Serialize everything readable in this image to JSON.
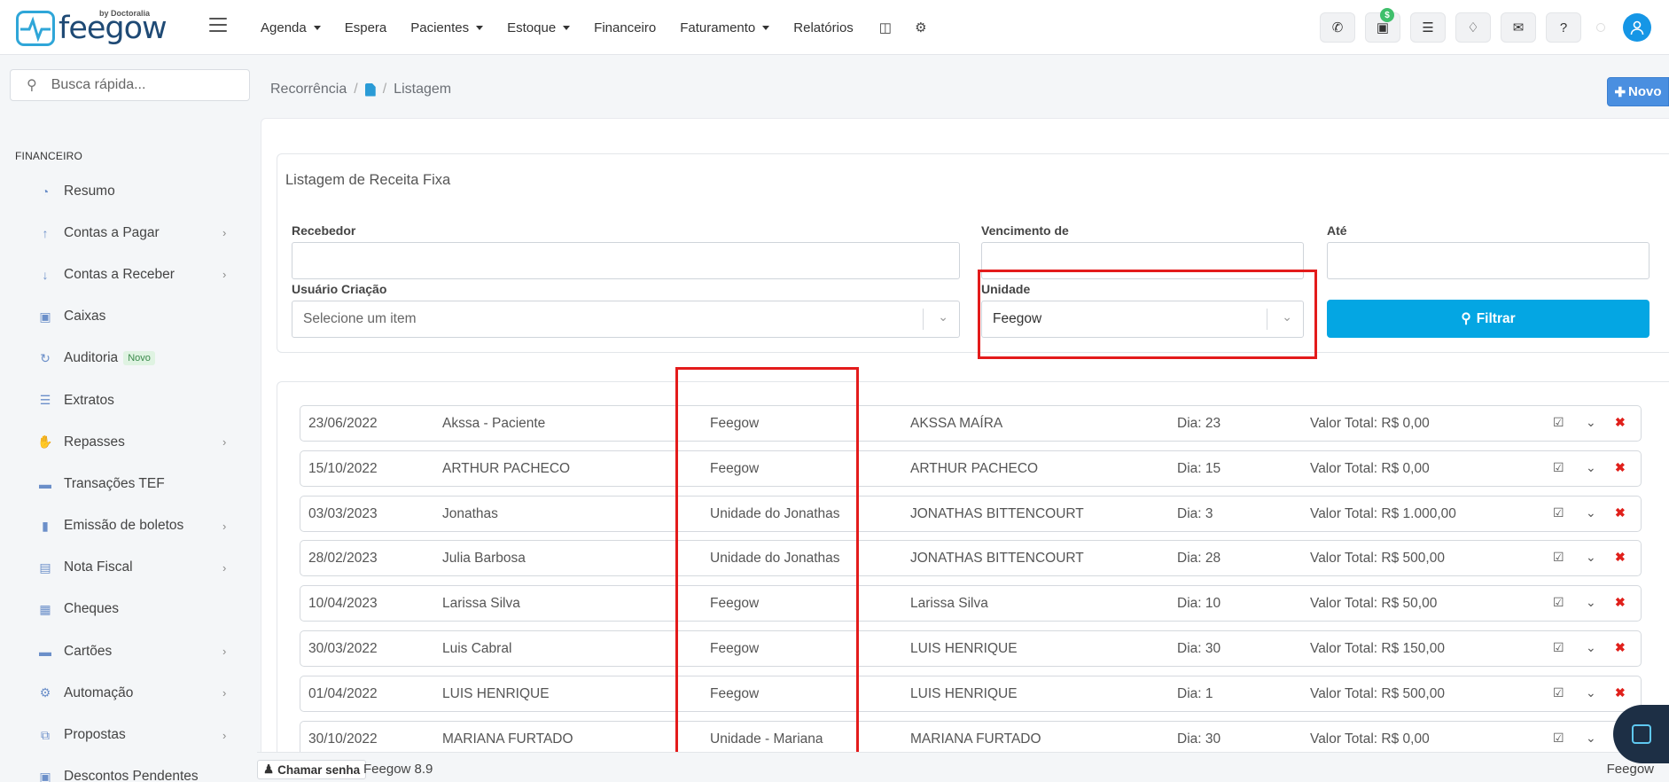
{
  "brand": {
    "name": "feegow",
    "by": "by Doctoralia"
  },
  "nav": [
    {
      "label": "Agenda",
      "caret": true
    },
    {
      "label": "Espera",
      "caret": false
    },
    {
      "label": "Pacientes",
      "caret": true
    },
    {
      "label": "Estoque",
      "caret": true
    },
    {
      "label": "Financeiro",
      "caret": false
    },
    {
      "label": "Faturamento",
      "caret": true
    },
    {
      "label": "Relatórios",
      "caret": false
    }
  ],
  "topbar_icons": [
    "phone-icon",
    "inbox-icon",
    "tasks-icon",
    "bell-icon",
    "chat-icon",
    "help-icon"
  ],
  "inbox_badge": "$",
  "search": {
    "placeholder": "Busca rápida..."
  },
  "sidebar": {
    "section": "FINANCEIRO",
    "items": [
      {
        "label": "Resumo",
        "icon": "pie-chart-icon",
        "chevron": false
      },
      {
        "label": "Contas a Pagar",
        "icon": "arrow-up-circle-icon",
        "chevron": true
      },
      {
        "label": "Contas a Receber",
        "icon": "arrow-down-circle-icon",
        "chevron": true
      },
      {
        "label": "Caixas",
        "icon": "inbox-icon",
        "chevron": false
      },
      {
        "label": "Auditoria",
        "icon": "history-icon",
        "chevron": false,
        "badge": "Novo"
      },
      {
        "label": "Extratos",
        "icon": "list-icon",
        "chevron": false
      },
      {
        "label": "Repasses",
        "icon": "hand-money-icon",
        "chevron": true
      },
      {
        "label": "Transações TEF",
        "icon": "credit-card-icon",
        "chevron": false
      },
      {
        "label": "Emissão de boletos",
        "icon": "barcode-icon",
        "chevron": true
      },
      {
        "label": "Nota Fiscal",
        "icon": "document-icon",
        "chevron": true
      },
      {
        "label": "Cheques",
        "icon": "check-list-icon",
        "chevron": false
      },
      {
        "label": "Cartões",
        "icon": "card-icon",
        "chevron": true
      },
      {
        "label": "Automação",
        "icon": "gears-icon",
        "chevron": true
      },
      {
        "label": "Propostas",
        "icon": "copy-icon",
        "chevron": true
      },
      {
        "label": "Descontos Pendentes",
        "icon": "discount-icon",
        "chevron": false
      }
    ]
  },
  "breadcrumb": {
    "first": "Recorrência",
    "last": "Listagem"
  },
  "new_button": "Novo",
  "filter": {
    "title": "Listagem de Receita Fixa",
    "recebedor_label": "Recebedor",
    "vencimento_label": "Vencimento de",
    "ate_label": "Até",
    "usuario_label": "Usuário Criação",
    "usuario_value": "Selecione um item",
    "unidade_label": "Unidade",
    "unidade_value": "Feegow",
    "submit": "Filtrar"
  },
  "rows": [
    {
      "date": "23/06/2022",
      "name": "Akssa - Paciente",
      "unit": "Feegow",
      "receiver": "AKSSA MAÍRA",
      "day": "Dia: 23",
      "total": "Valor Total: R$ 0,00"
    },
    {
      "date": "15/10/2022",
      "name": "ARTHUR PACHECO",
      "unit": "Feegow",
      "receiver": "ARTHUR PACHECO",
      "day": "Dia: 15",
      "total": "Valor Total: R$ 0,00"
    },
    {
      "date": "03/03/2023",
      "name": "Jonathas",
      "unit": "Unidade do Jonathas",
      "receiver": "JONATHAS BITTENCOURT",
      "day": "Dia: 3",
      "total": "Valor Total: R$ 1.000,00"
    },
    {
      "date": "28/02/2023",
      "name": "Julia Barbosa",
      "unit": "Unidade do Jonathas",
      "receiver": "JONATHAS BITTENCOURT",
      "day": "Dia: 28",
      "total": "Valor Total: R$ 500,00"
    },
    {
      "date": "10/04/2023",
      "name": "Larissa Silva",
      "unit": "Feegow",
      "receiver": "Larissa Silva",
      "day": "Dia: 10",
      "total": "Valor Total: R$ 50,00"
    },
    {
      "date": "30/03/2022",
      "name": "Luis Cabral",
      "unit": "Feegow",
      "receiver": "LUIS HENRIQUE",
      "day": "Dia: 30",
      "total": "Valor Total: R$ 150,00"
    },
    {
      "date": "01/04/2022",
      "name": "LUIS HENRIQUE",
      "unit": "Feegow",
      "receiver": "LUIS HENRIQUE",
      "day": "Dia: 1",
      "total": "Valor Total: R$ 500,00"
    },
    {
      "date": "30/10/2022",
      "name": "MARIANA FURTADO",
      "unit": "Unidade - Mariana",
      "receiver": "MARIANA FURTADO",
      "day": "Dia: 30",
      "total": "Valor Total: R$ 0,00"
    }
  ],
  "footer": {
    "call": "Chamar senha",
    "version": "Feegow 8.9",
    "right": "Feegow"
  },
  "colors": {
    "accent": "#04a6e3",
    "highlight": "#e31b1b",
    "delete": "#e0201b",
    "new_button": "#4a8fe0"
  }
}
